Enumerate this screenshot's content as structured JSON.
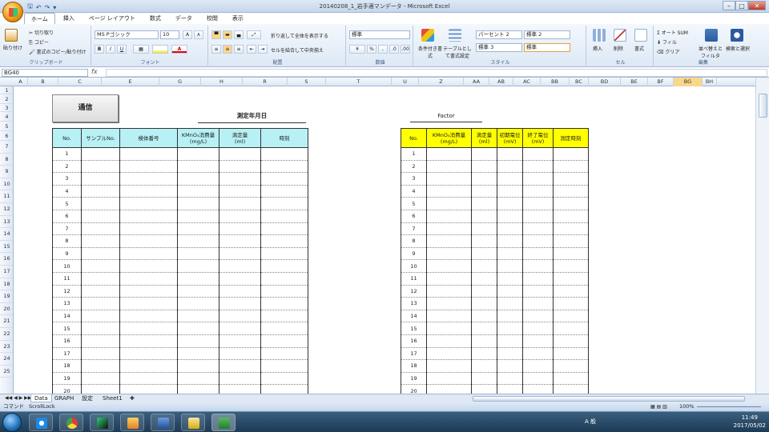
{
  "window": {
    "title": "20140208_1_岩手適マンデータ - Microsoft Excel"
  },
  "qat": {
    "save": "🖫",
    "undo": "↶",
    "redo": "↷",
    "dropdown": "▾"
  },
  "window_controls": {
    "minimize": "–",
    "maximize": "□",
    "close": "✕"
  },
  "tabs": [
    "ホーム",
    "挿入",
    "ページ レイアウト",
    "数式",
    "データ",
    "校閲",
    "表示"
  ],
  "ribbon": {
    "clipboard": {
      "label": "クリップボード",
      "paste": "貼り付け",
      "cut": "切り取り",
      "copy": "コピー",
      "format_copy": "書式のコピー/貼り付け"
    },
    "font": {
      "label": "フォント",
      "name": "MS Pゴシック",
      "size": "10",
      "grow": "A",
      "shrink": "A",
      "bold": "B",
      "italic": "I",
      "underline": "U",
      "color_a": "A"
    },
    "alignment": {
      "label": "配置",
      "wrap": "折り返して全体を表示する",
      "merge": "セルを結合して中央揃え"
    },
    "number": {
      "label": "数値",
      "format": "標準",
      "percent": "%",
      "comma": ","
    },
    "styles": {
      "label": "スタイル",
      "cond": "条件付き書式",
      "table": "テーブルとして書式設定",
      "s1": "パーセント 2",
      "s2": "標準 2",
      "s3": "標準 3",
      "s4": "標準"
    },
    "cells": {
      "label": "セル",
      "insert": "挿入",
      "delete": "削除",
      "format": "書式"
    },
    "editing": {
      "label": "編集",
      "autosum": "Σ オート SUM",
      "fill": "フィル",
      "clear": "クリア",
      "sort": "並べ替えとフィルタ",
      "find": "検索と選択"
    }
  },
  "formula_bar": {
    "name_box": "BG40",
    "fx": "fx",
    "value": ""
  },
  "columns": [
    "A",
    "B",
    "C",
    "E",
    "G",
    "H",
    "R",
    "S",
    "T",
    "U",
    "Z",
    "AA",
    "AB",
    "AC",
    "BB",
    "BC",
    "BD",
    "BE",
    "BF",
    "BG",
    "BH"
  ],
  "selected_column": "BG",
  "rows": [
    "1",
    "2",
    "3",
    "4",
    "5",
    "6",
    "7",
    "8",
    "9",
    "10",
    "11",
    "12",
    "13",
    "14",
    "15",
    "16",
    "17",
    "18",
    "19",
    "20",
    "21",
    "22",
    "23",
    "24",
    "25"
  ],
  "sheet": {
    "button": "通信",
    "date_title": "測定年月日",
    "factor_title": "Factor",
    "left_table": {
      "headers": [
        "No.",
        "サンプルNo.",
        "検体番号",
        "KMnO₄消費量\n(mg/L)",
        "滴定量\n(ml)",
        "時刻"
      ],
      "row_numbers": [
        "1",
        "2",
        "3",
        "4",
        "5",
        "6",
        "7",
        "8",
        "9",
        "10",
        "11",
        "12",
        "13",
        "14",
        "15",
        "16",
        "17",
        "18",
        "19",
        "20"
      ]
    },
    "right_table": {
      "headers": [
        "No.",
        "KMnO₄消費量\n(mg/L)",
        "滴定量\n(ml)",
        "初期電位\n(mV)",
        "終了電位\n(mV)",
        "測定時刻"
      ],
      "row_numbers": [
        "1",
        "2",
        "3",
        "4",
        "5",
        "6",
        "7",
        "8",
        "9",
        "10",
        "11",
        "12",
        "13",
        "14",
        "15",
        "16",
        "17",
        "18",
        "19",
        "20"
      ]
    },
    "header_colors": {
      "left": "#b7f0f5",
      "right": "#ffff00"
    }
  },
  "sheet_tabs": [
    "Data",
    "GRAPH",
    "設定",
    "Sheet1"
  ],
  "active_sheet": "Data",
  "status": {
    "mode": "コマンド",
    "scroll": "ScrollLock",
    "zoom": "100%"
  },
  "taskbar": {
    "ime": "A 般",
    "time": "11:49",
    "date": "2017/05/02"
  }
}
